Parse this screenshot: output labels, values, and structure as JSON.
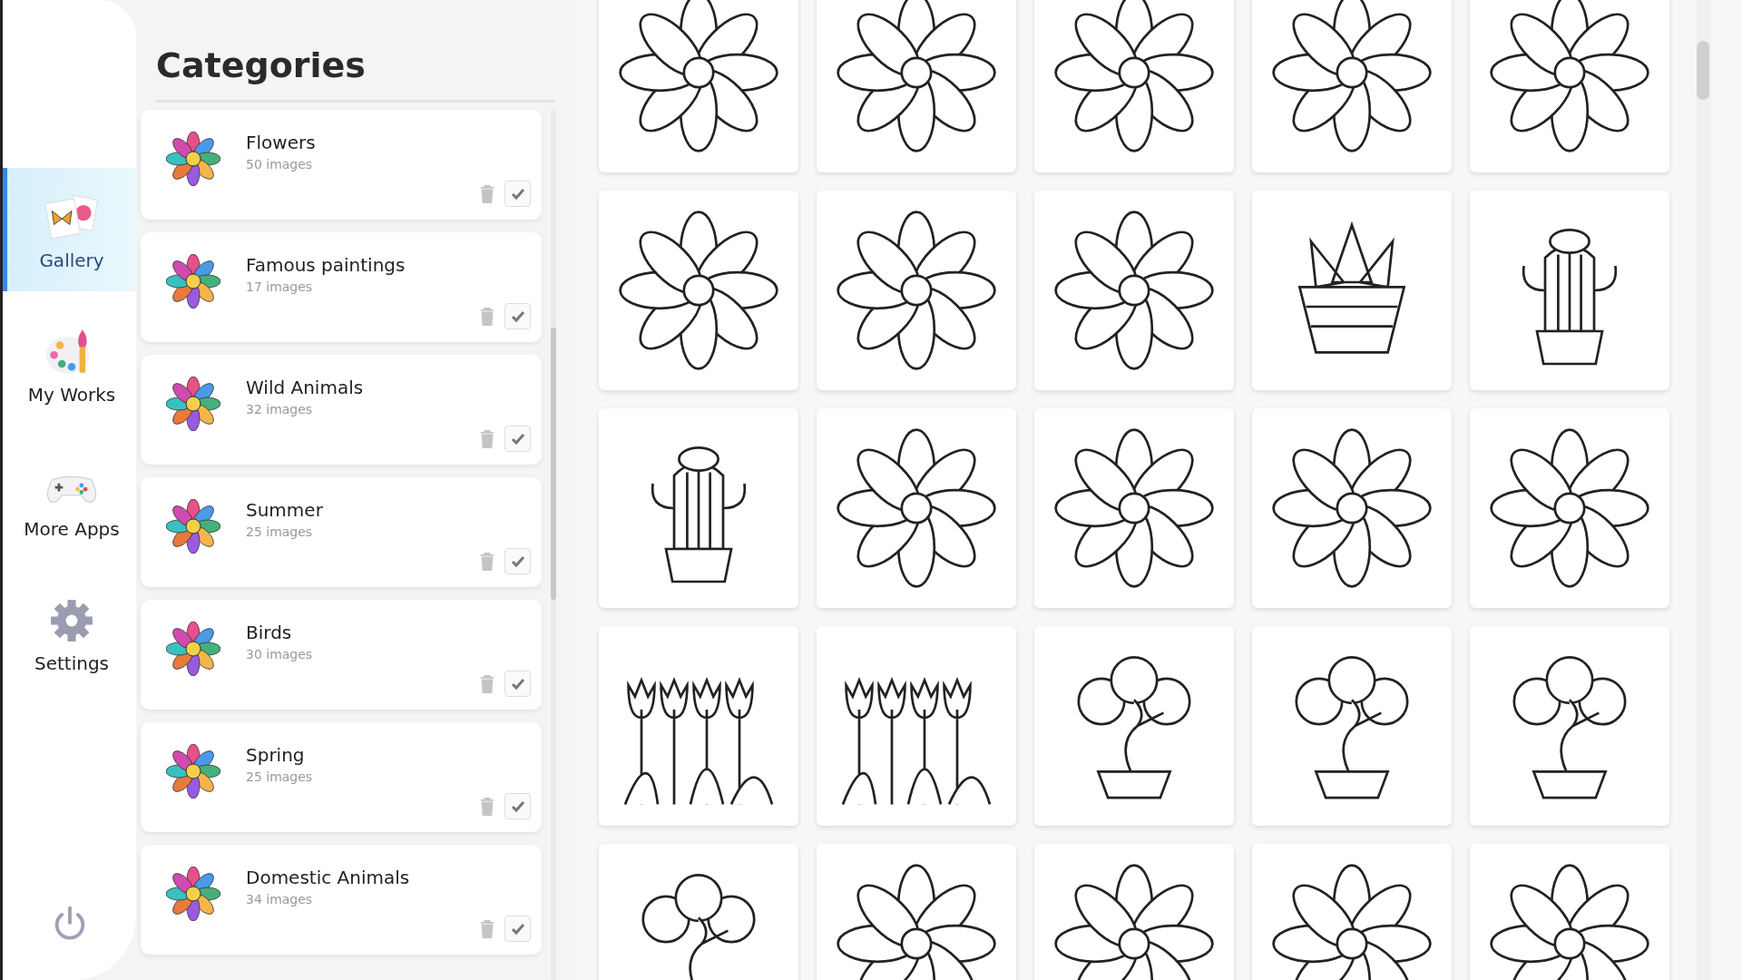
{
  "nav": {
    "items": [
      {
        "kind": "gallery",
        "label": "Gallery",
        "selected": true
      },
      {
        "kind": "palette",
        "label": "My Works",
        "selected": false
      },
      {
        "kind": "gamepad",
        "label": "More Apps",
        "selected": false
      },
      {
        "kind": "gear",
        "label": "Settings",
        "selected": false
      }
    ]
  },
  "categories": {
    "title": "Categories",
    "items": [
      {
        "name": "Flowers",
        "count": "50 images",
        "checked": true
      },
      {
        "name": "Famous paintings",
        "count": "17 images",
        "checked": true
      },
      {
        "name": "Wild Animals",
        "count": "32 images",
        "checked": true
      },
      {
        "name": "Summer",
        "count": "25 images",
        "checked": true
      },
      {
        "name": "Birds",
        "count": "30 images",
        "checked": true
      },
      {
        "name": "Spring",
        "count": "25 images",
        "checked": true
      },
      {
        "name": "Domestic Animals",
        "count": "34 images",
        "checked": true
      }
    ]
  },
  "gallery": {
    "tiles": [
      {
        "kind": "flower"
      },
      {
        "kind": "flower"
      },
      {
        "kind": "flower"
      },
      {
        "kind": "flower"
      },
      {
        "kind": "flower"
      },
      {
        "kind": "flower"
      },
      {
        "kind": "flower"
      },
      {
        "kind": "flower"
      },
      {
        "kind": "potted"
      },
      {
        "kind": "cactus"
      },
      {
        "kind": "cactus"
      },
      {
        "kind": "flower"
      },
      {
        "kind": "flower"
      },
      {
        "kind": "flower"
      },
      {
        "kind": "flower"
      },
      {
        "kind": "tulips"
      },
      {
        "kind": "tulips"
      },
      {
        "kind": "bonsai"
      },
      {
        "kind": "bonsai"
      },
      {
        "kind": "bonsai"
      },
      {
        "kind": "bonsai"
      },
      {
        "kind": "flower"
      },
      {
        "kind": "flower"
      },
      {
        "kind": "flower"
      },
      {
        "kind": "flower"
      }
    ]
  }
}
